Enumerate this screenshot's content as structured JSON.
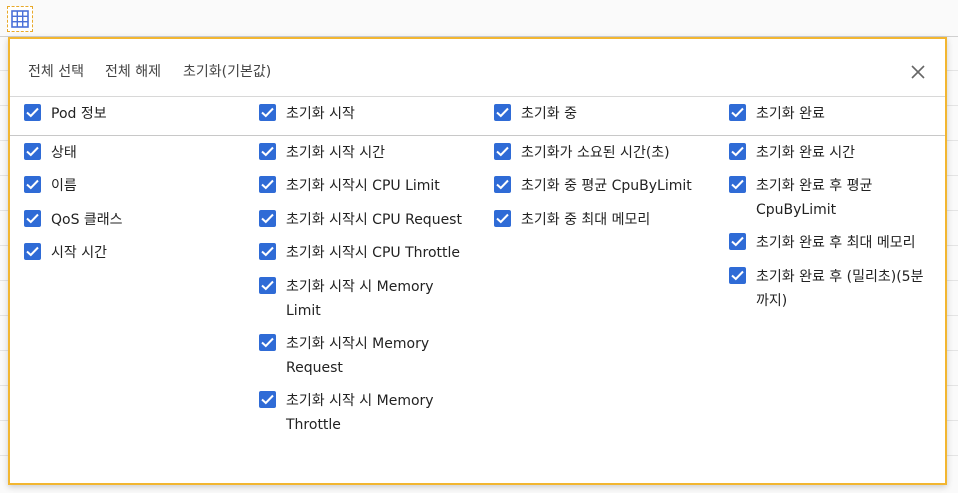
{
  "toolbar": {
    "select_all": "전체 선택",
    "deselect_all": "전체 해제",
    "reset_default": "초기화(기본값)"
  },
  "columns": [
    {
      "header": "Pod 정보",
      "items": [
        "상태",
        "이름",
        "QoS 클래스",
        "시작 시간"
      ]
    },
    {
      "header": "초기화 시작",
      "items": [
        "초기화 시작 시간",
        "초기화 시작시 CPU Limit",
        "초기화 시작시 CPU Request",
        "초기화 시작시 CPU Throttle",
        "초기화 시작 시 Memory Limit",
        "초기화 시작시 Memory Request",
        "초기화 시작 시 Memory Throttle"
      ]
    },
    {
      "header": "초기화 중",
      "items": [
        "초기화가 소요된 시간(초)",
        "초기화 중 평균 CpuByLimit",
        "초기화 중 최대 메모리"
      ]
    },
    {
      "header": "초기화 완료",
      "items": [
        "초기화 완료 시간",
        "초기화 완료 후 평균 CpuByLimit",
        "초기화 완료 후 최대 메모리",
        "초기화 완료 후 (밀리초)(5분까지)"
      ]
    }
  ],
  "colors": {
    "checkbox": "#2f6bd6",
    "panel_border": "#f2b631"
  }
}
